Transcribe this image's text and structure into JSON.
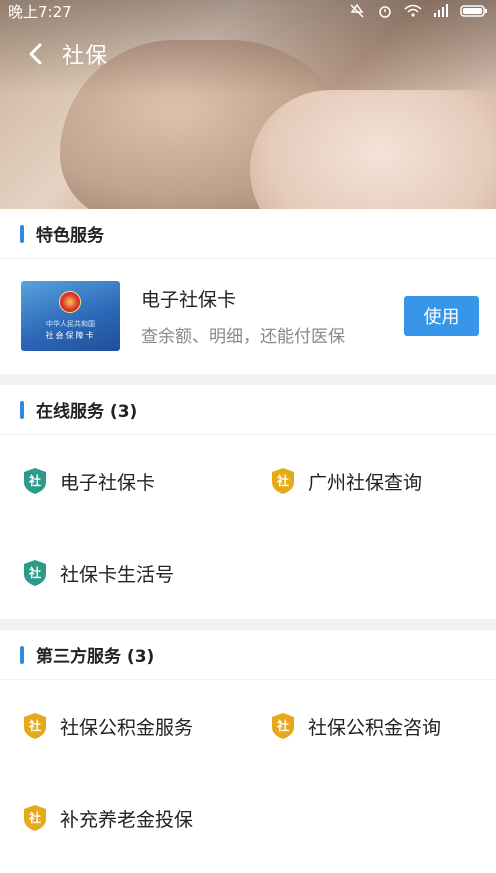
{
  "status_bar": {
    "time": "晚上7:27"
  },
  "header": {
    "title": "社保"
  },
  "featured": {
    "section_title": "特色服务",
    "card": {
      "title": "电子社保卡",
      "subtitle": "查余额、明细，还能付医保",
      "button_label": "使用",
      "image_text_small": "中华人民共和国",
      "image_text_main": "社会保障卡"
    }
  },
  "online": {
    "section_title": "在线服务 (3)",
    "items": [
      {
        "label": "电子社保卡",
        "icon_char": "社",
        "color": "#2e9a8a"
      },
      {
        "label": "广州社保查询",
        "icon_char": "社",
        "color": "#e5a91a"
      },
      {
        "label": "社保卡生活号",
        "icon_char": "社",
        "color": "#2e9a8a"
      }
    ]
  },
  "third_party": {
    "section_title": "第三方服务 (3)",
    "items": [
      {
        "label": "社保公积金服务",
        "icon_char": "社",
        "color": "#e5a91a"
      },
      {
        "label": "社保公积金咨询",
        "icon_char": "社",
        "color": "#e5a91a"
      },
      {
        "label": "补充养老金投保",
        "icon_char": "社",
        "color": "#e5a91a"
      }
    ]
  },
  "colors": {
    "accent": "#3796e8",
    "section_bar": "#2f8ae3"
  }
}
